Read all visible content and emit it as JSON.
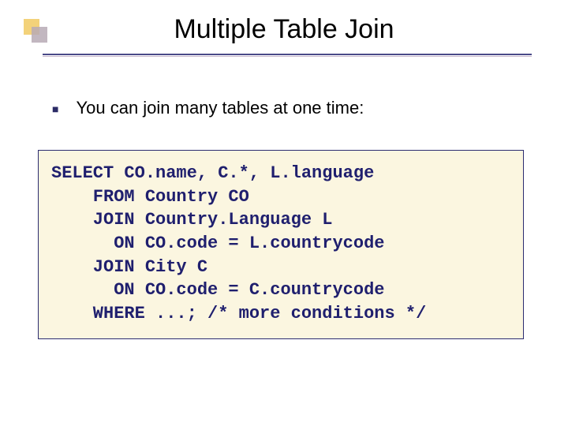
{
  "title": "Multiple Table Join",
  "bullet": {
    "text": "You can join many tables at one time:"
  },
  "code": {
    "lines": [
      "SELECT CO.name, C.*, L.language",
      "    FROM Country CO",
      "    JOIN Country.Language L",
      "      ON CO.code = L.countrycode",
      "    JOIN City C",
      "      ON CO.code = C.countrycode",
      "    WHERE ...; /* more conditions */"
    ]
  }
}
